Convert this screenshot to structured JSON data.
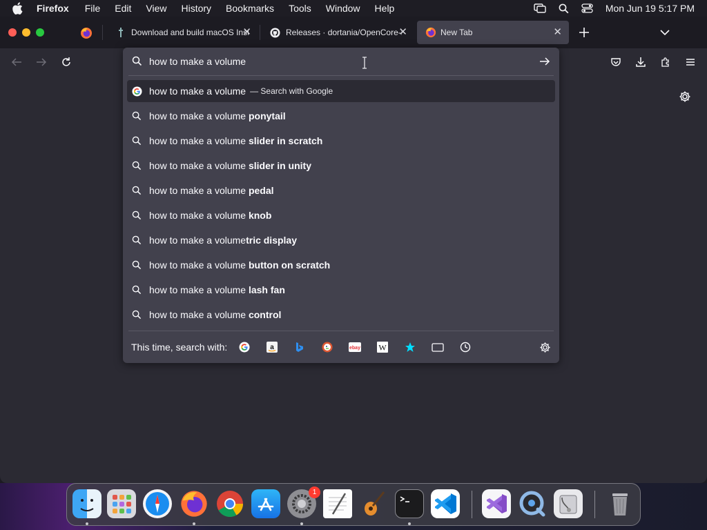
{
  "menubar": {
    "app_name": "Firefox",
    "items": [
      "File",
      "Edit",
      "View",
      "History",
      "Bookmarks",
      "Tools",
      "Window",
      "Help"
    ],
    "clock": "Mon Jun 19  5:17 PM"
  },
  "tabs": [
    {
      "label": "Download and build macOS Installers",
      "active": false
    },
    {
      "label": "Releases · dortania/OpenCore-Legacy-Patcher",
      "active": false
    },
    {
      "label": "New Tab",
      "active": true
    }
  ],
  "urlbar": {
    "query": "how to make a volume",
    "results": [
      {
        "prefix": "how to make a volume",
        "bold": "",
        "action": "— Search with Google",
        "icon": "google-icon"
      },
      {
        "prefix": "how to make a volume ",
        "bold": "ponytail",
        "icon": "search-icon"
      },
      {
        "prefix": "how to make a volume ",
        "bold": "slider in scratch",
        "icon": "search-icon"
      },
      {
        "prefix": "how to make a volume ",
        "bold": "slider in unity",
        "icon": "search-icon"
      },
      {
        "prefix": "how to make a volume ",
        "bold": "pedal",
        "icon": "search-icon"
      },
      {
        "prefix": "how to make a volume ",
        "bold": "knob",
        "icon": "search-icon"
      },
      {
        "prefix": "how to make a volume",
        "bold": "tric display",
        "icon": "search-icon"
      },
      {
        "prefix": "how to make a volume ",
        "bold": "button on scratch",
        "icon": "search-icon"
      },
      {
        "prefix": "how to make a volume ",
        "bold": "lash fan",
        "icon": "search-icon"
      },
      {
        "prefix": "how to make a volume ",
        "bold": "control",
        "icon": "search-icon"
      }
    ],
    "oneoff_label": "This time, search with:",
    "engines": [
      "google-icon",
      "amazon-icon",
      "bing-icon",
      "duckduckgo-icon",
      "ebay-icon",
      "wikipedia-icon",
      "bookmarks-icon",
      "tabs-icon",
      "history-icon"
    ]
  },
  "dock": {
    "apps": [
      "finder",
      "launchpad",
      "safari",
      "firefox",
      "chrome",
      "app-store",
      "system-settings",
      "textedit",
      "garageband",
      "terminal",
      "vscode",
      "visual-studio",
      "quicktime",
      "disk-utility",
      "trash"
    ],
    "system_settings_badge": "1"
  },
  "colors": {
    "accent": "#0a84ff",
    "popup_bg": "#42414d",
    "toolbar_bg": "#2b2a33"
  }
}
